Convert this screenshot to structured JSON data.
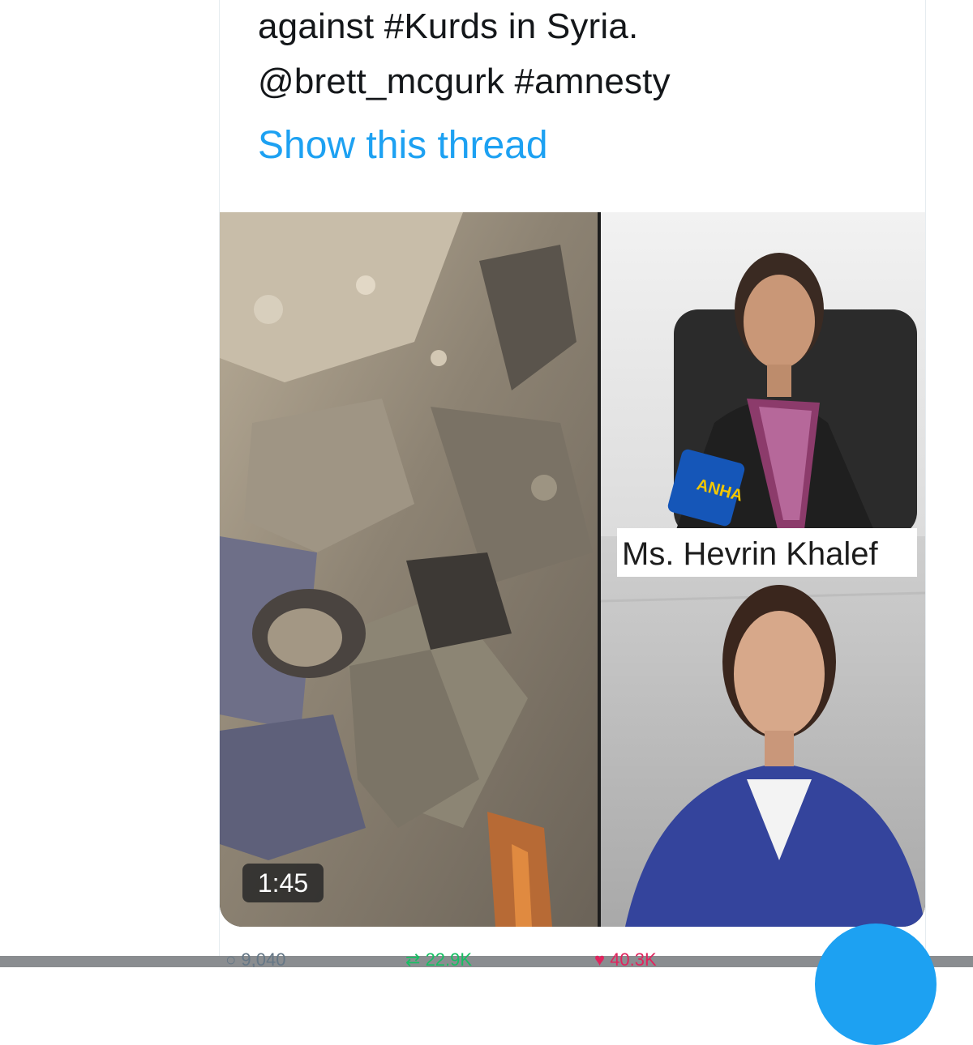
{
  "tweet": {
    "text_line1": "against #Kurds in Syria.",
    "text_line2": "@brett_mcgurk #amnesty",
    "show_thread": "Show this thread"
  },
  "media": {
    "caption": "Ms. Hevrin Khalef",
    "mic_label": "ANHA",
    "duration": "1:45"
  },
  "actions": {
    "reply_count": "9,040",
    "retweet_count": "22.9K",
    "like_count": "40.3K"
  },
  "colors": {
    "link": "#1da1f2",
    "text": "#14171a",
    "muted": "#657786"
  }
}
